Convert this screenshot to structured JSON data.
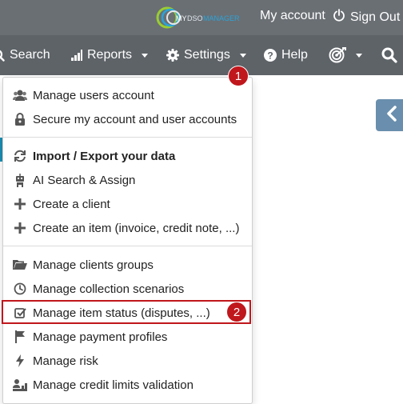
{
  "header": {
    "logo_text_my": "MY",
    "logo_text_dso": "DSO",
    "logo_text_manager": "MANAGER",
    "my_account_label": "My account",
    "sign_out_label": "Sign Out"
  },
  "nav": {
    "search_label": "Search",
    "reports_label": "Reports",
    "settings_label": "Settings",
    "help_label": "Help"
  },
  "settings_menu": {
    "items": [
      {
        "label": "Manage users account",
        "icon": "users-icon"
      },
      {
        "label": "Secure my account and user accounts",
        "icon": "lock-icon"
      },
      {
        "label": "Import / Export your data",
        "icon": "sync-icon"
      },
      {
        "label": "AI Search & Assign",
        "icon": "robot-icon"
      },
      {
        "label": "Create a client",
        "icon": "plus-icon"
      },
      {
        "label": "Create an item (invoice, credit note, ...)",
        "icon": "plus-icon"
      },
      {
        "label": "Manage clients groups",
        "icon": "folder-icon"
      },
      {
        "label": "Manage collection scenarios",
        "icon": "clock-icon"
      },
      {
        "label": "Manage item status (disputes, ...)",
        "icon": "checkbox-icon"
      },
      {
        "label": "Manage payment profiles",
        "icon": "flag-icon"
      },
      {
        "label": "Manage risk",
        "icon": "bolt-icon"
      },
      {
        "label": "Manage credit limits validation",
        "icon": "user-chart-icon"
      }
    ]
  },
  "annotations": {
    "badge_1": "1",
    "badge_2": "2"
  },
  "colors": {
    "header_bg": "#6a6f74",
    "nav_bg": "#5e6368",
    "annotation_red": "#c0171c",
    "accent_blue": "#1c8fb5"
  }
}
